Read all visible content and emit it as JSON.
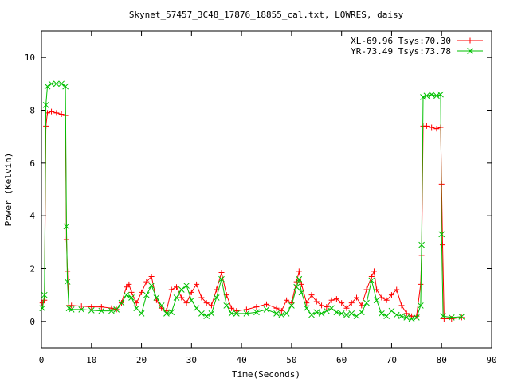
{
  "chart_data": {
    "type": "line",
    "title": "Skynet_57457_3C48_17876_18855_cal.txt, LOWRES, daisy",
    "xlabel": "Time(Seconds)",
    "ylabel": "Power (Kelvin)",
    "xlim": [
      0,
      90
    ],
    "ylim": [
      -1,
      11
    ],
    "xticks": [
      0,
      10,
      20,
      30,
      40,
      50,
      60,
      70,
      80,
      90
    ],
    "yticks": [
      0,
      2,
      4,
      6,
      8,
      10
    ],
    "grid": false,
    "legend_position": "top-right",
    "series": [
      {
        "name": "XL-69.96 Tsys:70.30",
        "color": "#ff0000",
        "marker": "plus",
        "points": [
          [
            0.2,
            0.7
          ],
          [
            0.6,
            0.8
          ],
          [
            0.9,
            7.4
          ],
          [
            1.2,
            7.9
          ],
          [
            2,
            7.95
          ],
          [
            3,
            7.9
          ],
          [
            4,
            7.85
          ],
          [
            4.8,
            7.8
          ],
          [
            5.0,
            3.1
          ],
          [
            5.2,
            1.9
          ],
          [
            5.5,
            0.6
          ],
          [
            6,
            0.6
          ],
          [
            8,
            0.58
          ],
          [
            10,
            0.55
          ],
          [
            12,
            0.55
          ],
          [
            14,
            0.5
          ],
          [
            15,
            0.45
          ],
          [
            16,
            0.7
          ],
          [
            17,
            1.3
          ],
          [
            17.5,
            1.4
          ],
          [
            18,
            1.1
          ],
          [
            19,
            0.7
          ],
          [
            20,
            1.1
          ],
          [
            21,
            1.5
          ],
          [
            22,
            1.7
          ],
          [
            23,
            0.8
          ],
          [
            24,
            0.5
          ],
          [
            25,
            0.4
          ],
          [
            26,
            1.2
          ],
          [
            27,
            1.3
          ],
          [
            28,
            0.9
          ],
          [
            29,
            0.7
          ],
          [
            30,
            1.1
          ],
          [
            31,
            1.4
          ],
          [
            32,
            0.9
          ],
          [
            33,
            0.7
          ],
          [
            34,
            0.6
          ],
          [
            35,
            1.2
          ],
          [
            36,
            1.85
          ],
          [
            37,
            1.0
          ],
          [
            38,
            0.5
          ],
          [
            39,
            0.4
          ],
          [
            41,
            0.45
          ],
          [
            43,
            0.55
          ],
          [
            45,
            0.65
          ],
          [
            47,
            0.5
          ],
          [
            48,
            0.4
          ],
          [
            49,
            0.8
          ],
          [
            50,
            0.7
          ],
          [
            51,
            1.5
          ],
          [
            51.5,
            1.9
          ],
          [
            52,
            1.4
          ],
          [
            53,
            0.7
          ],
          [
            54,
            1.0
          ],
          [
            55,
            0.75
          ],
          [
            56,
            0.6
          ],
          [
            57,
            0.55
          ],
          [
            58,
            0.8
          ],
          [
            59,
            0.85
          ],
          [
            60,
            0.7
          ],
          [
            61,
            0.5
          ],
          [
            62,
            0.7
          ],
          [
            63,
            0.9
          ],
          [
            64,
            0.6
          ],
          [
            65,
            1.2
          ],
          [
            66,
            1.7
          ],
          [
            66.5,
            1.9
          ],
          [
            67,
            1.2
          ],
          [
            68,
            0.9
          ],
          [
            69,
            0.8
          ],
          [
            70,
            1.0
          ],
          [
            71,
            1.2
          ],
          [
            72,
            0.6
          ],
          [
            73,
            0.3
          ],
          [
            74,
            0.2
          ],
          [
            75,
            0.2
          ],
          [
            75.8,
            1.4
          ],
          [
            76,
            2.5
          ],
          [
            76.3,
            7.4
          ],
          [
            77,
            7.4
          ],
          [
            78,
            7.35
          ],
          [
            79,
            7.3
          ],
          [
            79.8,
            7.35
          ],
          [
            80,
            5.2
          ],
          [
            80.2,
            2.9
          ],
          [
            80.5,
            0.1
          ],
          [
            82,
            0.1
          ],
          [
            84,
            0.15
          ]
        ]
      },
      {
        "name": "YR-73.49 Tsys:73.78",
        "color": "#00c000",
        "marker": "cross",
        "points": [
          [
            0.2,
            0.5
          ],
          [
            0.6,
            1.0
          ],
          [
            0.9,
            8.2
          ],
          [
            1.2,
            8.9
          ],
          [
            2,
            9.0
          ],
          [
            3,
            9.0
          ],
          [
            4,
            9.0
          ],
          [
            4.8,
            8.9
          ],
          [
            5.0,
            3.6
          ],
          [
            5.2,
            1.5
          ],
          [
            5.5,
            0.5
          ],
          [
            6,
            0.45
          ],
          [
            8,
            0.45
          ],
          [
            10,
            0.42
          ],
          [
            12,
            0.4
          ],
          [
            14,
            0.4
          ],
          [
            15,
            0.45
          ],
          [
            16,
            0.7
          ],
          [
            17,
            1.0
          ],
          [
            18,
            0.9
          ],
          [
            19,
            0.5
          ],
          [
            20,
            0.3
          ],
          [
            21,
            1.0
          ],
          [
            22,
            1.35
          ],
          [
            23,
            0.9
          ],
          [
            24,
            0.6
          ],
          [
            25,
            0.3
          ],
          [
            26,
            0.35
          ],
          [
            27,
            0.9
          ],
          [
            28,
            1.2
          ],
          [
            29,
            1.35
          ],
          [
            30,
            0.8
          ],
          [
            31,
            0.5
          ],
          [
            32,
            0.3
          ],
          [
            33,
            0.2
          ],
          [
            34,
            0.3
          ],
          [
            35,
            0.9
          ],
          [
            36,
            1.6
          ],
          [
            37,
            0.6
          ],
          [
            38,
            0.3
          ],
          [
            39,
            0.3
          ],
          [
            41,
            0.3
          ],
          [
            43,
            0.35
          ],
          [
            45,
            0.45
          ],
          [
            47,
            0.3
          ],
          [
            48,
            0.25
          ],
          [
            49,
            0.3
          ],
          [
            50,
            0.6
          ],
          [
            51,
            1.3
          ],
          [
            51.5,
            1.6
          ],
          [
            52,
            1.1
          ],
          [
            53,
            0.5
          ],
          [
            54,
            0.25
          ],
          [
            55,
            0.35
          ],
          [
            56,
            0.3
          ],
          [
            57,
            0.4
          ],
          [
            58,
            0.5
          ],
          [
            59,
            0.35
          ],
          [
            60,
            0.3
          ],
          [
            61,
            0.25
          ],
          [
            62,
            0.3
          ],
          [
            63,
            0.2
          ],
          [
            64,
            0.35
          ],
          [
            65,
            0.7
          ],
          [
            66,
            1.55
          ],
          [
            67,
            0.8
          ],
          [
            68,
            0.3
          ],
          [
            69,
            0.2
          ],
          [
            70,
            0.4
          ],
          [
            71,
            0.25
          ],
          [
            72,
            0.2
          ],
          [
            73,
            0.15
          ],
          [
            74,
            0.1
          ],
          [
            75,
            0.15
          ],
          [
            75.8,
            0.6
          ],
          [
            76,
            2.9
          ],
          [
            76.3,
            8.5
          ],
          [
            77,
            8.55
          ],
          [
            78,
            8.6
          ],
          [
            79,
            8.55
          ],
          [
            79.8,
            8.6
          ],
          [
            80,
            3.3
          ],
          [
            80.3,
            0.2
          ],
          [
            82,
            0.15
          ],
          [
            84,
            0.18
          ]
        ]
      }
    ]
  }
}
